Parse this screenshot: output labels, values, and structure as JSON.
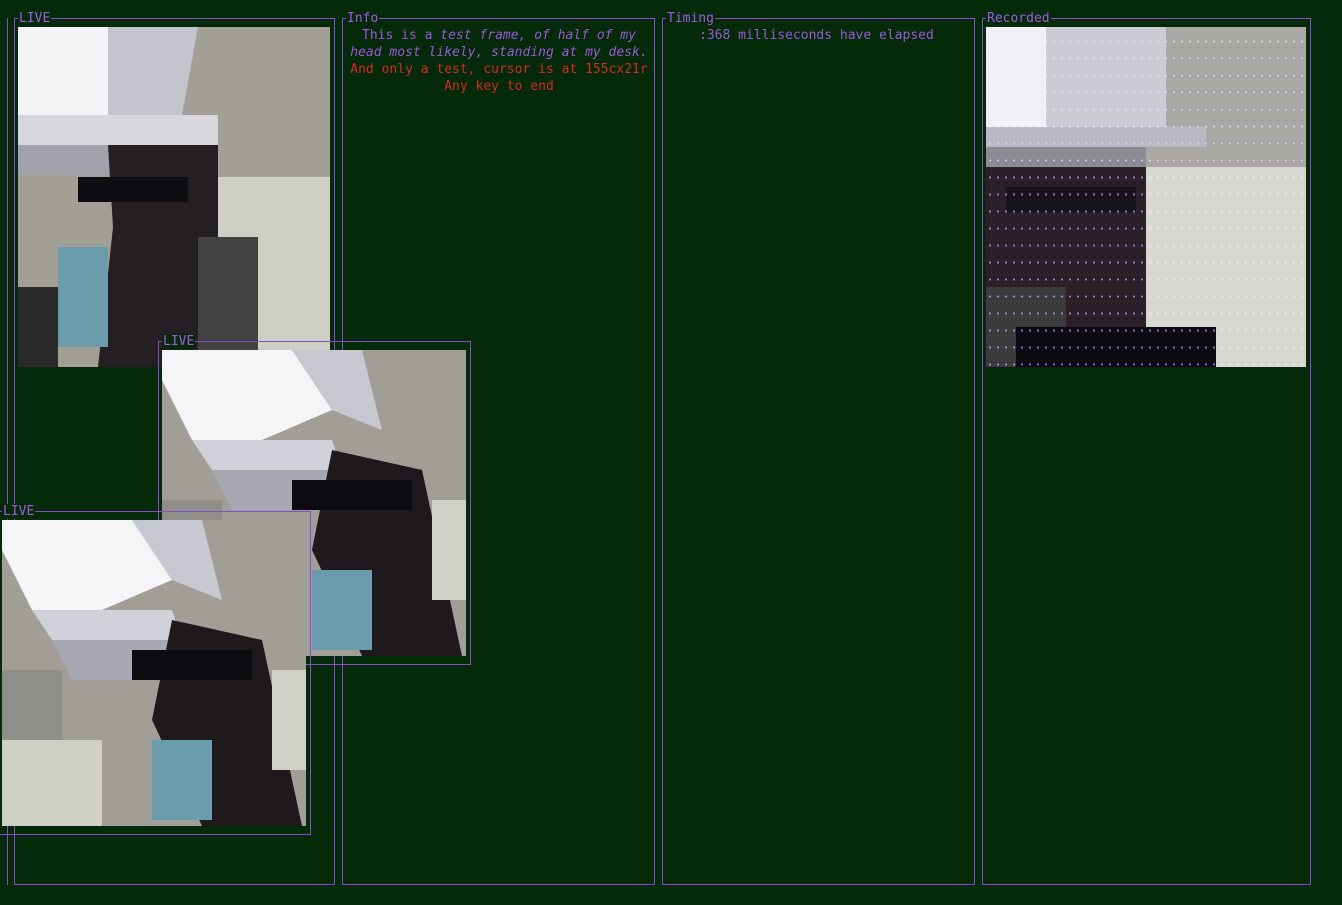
{
  "panels": {
    "live_1": {
      "title": "LIVE"
    },
    "live_2": {
      "title": "LIVE"
    },
    "live_3": {
      "title": "LIVE"
    },
    "info": {
      "title": "Info",
      "line1_plain": "This is a ",
      "line1_italic": "test frame, of half of my",
      "line2_italic": "head most likely, standing at my desk.",
      "line3": "And only a test, cursor is at 155cx21r",
      "line4": "Any key to end"
    },
    "timing": {
      "title": "Timing",
      "elapsed_text": ":368 milliseconds have elapsed"
    },
    "recorded": {
      "title": "Recorded"
    }
  },
  "colors": {
    "background": "#042a09",
    "border": "#8a4ccf",
    "text": "#9b59d6",
    "alert_text": "#d42b22"
  },
  "icons": [
    "camera-frame-live",
    "camera-frame-recorded"
  ]
}
